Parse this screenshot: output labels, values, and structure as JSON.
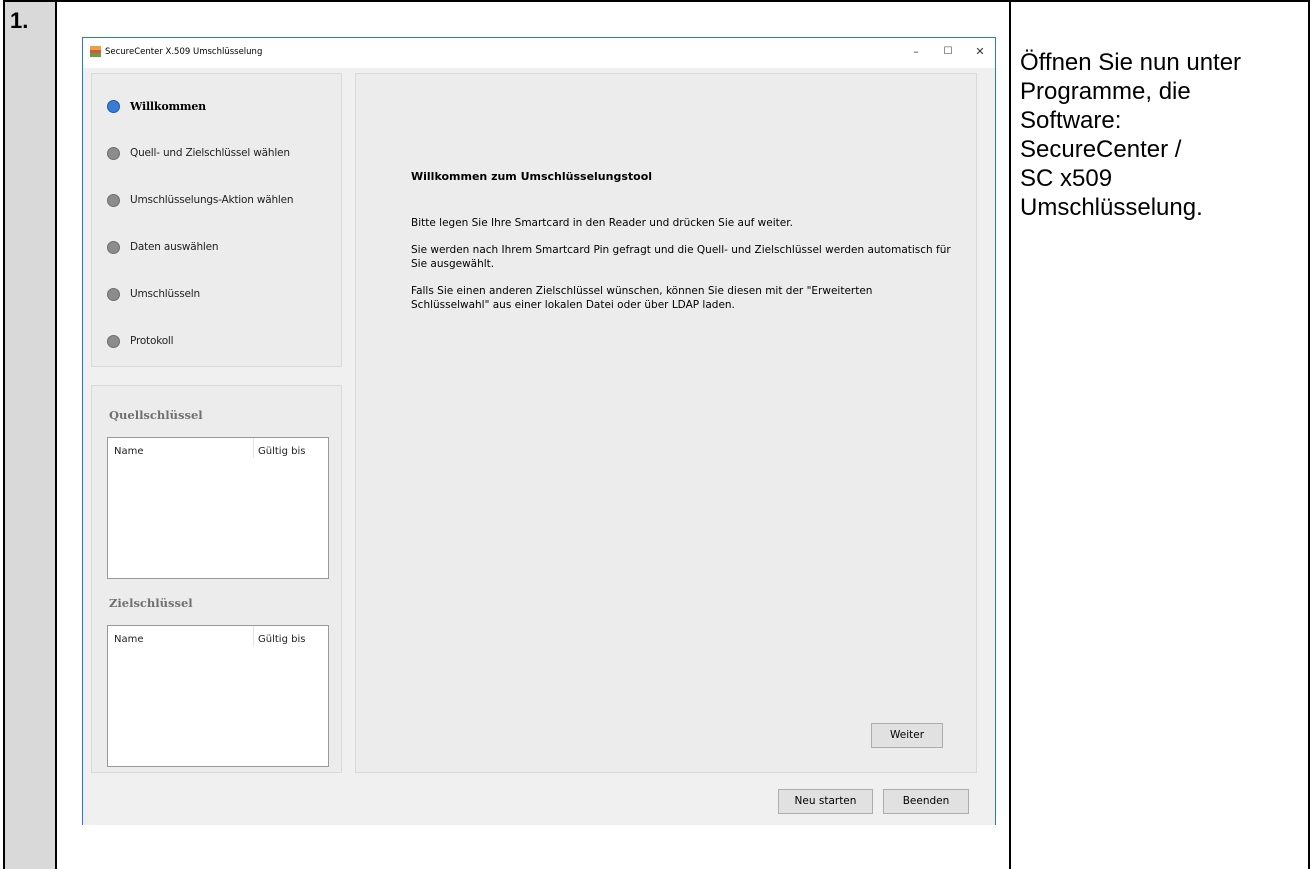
{
  "document": {
    "step_number": "1.",
    "description_lines": [
      "Öffnen Sie nun unter",
      "Programme, die",
      "Software:",
      "SecureCenter /",
      "SC x509",
      "Umschlüsselung."
    ]
  },
  "window": {
    "title": "SecureCenter X.509 Umschlüsselung",
    "controls": {
      "minimize": "–",
      "maximize": "☐",
      "close": "✕"
    }
  },
  "steps": [
    {
      "label": "Willkommen",
      "active": true
    },
    {
      "label": "Quell- und Zielschlüssel wählen",
      "active": false
    },
    {
      "label": "Umschlüsselungs-Aktion wählen",
      "active": false
    },
    {
      "label": "Daten auswählen",
      "active": false
    },
    {
      "label": "Umschlüsseln",
      "active": false
    },
    {
      "label": "Protokoll",
      "active": false
    }
  ],
  "keys": {
    "source": {
      "heading": "Quellschlüssel",
      "col_name": "Name",
      "col_valid": "Gültig bis"
    },
    "target": {
      "heading": "Zielschlüssel",
      "col_name": "Name",
      "col_valid": "Gültig bis"
    }
  },
  "main": {
    "title": "Willkommen zum Umschlüsselungstool",
    "p1": "Bitte legen Sie Ihre Smartcard in den Reader und drücken Sie auf weiter.",
    "p2_line1": "Sie werden nach Ihrem Smartcard Pin gefragt und die Quell- und Zielschlüssel werden automatisch für",
    "p2_line2": "Sie ausgewählt.",
    "p3_line1": "Falls Sie einen anderen Zielschlüssel wünschen, können Sie diesen mit der \"Erweiterten",
    "p3_line2": "Schlüsselwahl\" aus einer lokalen Datei oder über LDAP laden."
  },
  "buttons": {
    "next": "Weiter",
    "restart": "Neu starten",
    "quit": "Beenden"
  },
  "colors": {
    "active_step": "#3a7bd5",
    "inactive_step": "#8c8c8c",
    "window_border": "#2b78d4"
  }
}
